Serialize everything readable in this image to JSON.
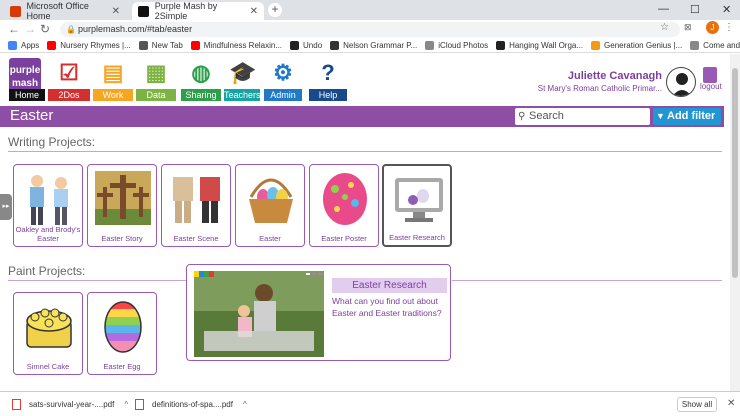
{
  "browser": {
    "tabs": [
      {
        "label": "Microsoft Office Home",
        "favicon_color": "#d83b01",
        "active": false
      },
      {
        "label": "Purple Mash by 2Simple",
        "favicon_color": "#111111",
        "active": true
      }
    ],
    "url": "purplemash.com/#tab/easter",
    "profile_initial": "J",
    "bookmarks": [
      {
        "label": "Apps",
        "icon_color": "#4285f4"
      },
      {
        "label": "Nursery Rhymes |...",
        "icon_color": "#ff0000"
      },
      {
        "label": "New Tab",
        "icon_color": "#555555"
      },
      {
        "label": "Mindfulness Relaxin...",
        "icon_color": "#ff0000"
      },
      {
        "label": "Undo",
        "icon_color": "#222222"
      },
      {
        "label": "Nelson Grammar P...",
        "icon_color": "#333333"
      },
      {
        "label": "iCloud Photos",
        "icon_color": "#888888"
      },
      {
        "label": "Hanging Wall Orga...",
        "icon_color": "#222222"
      },
      {
        "label": "Generation Genius |...",
        "icon_color": "#f39c12"
      },
      {
        "label": "Come and See",
        "icon_color": "#888888"
      }
    ]
  },
  "app": {
    "logo_top": "purple",
    "logo_bottom": "mash",
    "nav": [
      {
        "label": "Home",
        "color": "#111111"
      },
      {
        "label": "2Dos",
        "color": "#d32f2f"
      },
      {
        "label": "Work",
        "color": "#f5a623"
      },
      {
        "label": "Data",
        "color": "#7cb342"
      },
      {
        "label": "Sharing",
        "color": "#2e9e4a"
      },
      {
        "label": "Teachers",
        "color": "#16a3a3"
      },
      {
        "label": "Admin",
        "color": "#1f79c7"
      },
      {
        "label": "Help",
        "color": "#174a8b"
      }
    ],
    "user_name": "Juliette Cavanagh",
    "school": "St Mary's Roman Catholic Primar...",
    "logout_label": "logout"
  },
  "toolbar": {
    "title": "Easter",
    "search_placeholder": "Search",
    "filter_label": "Add filter"
  },
  "sections": [
    {
      "title": "Writing Projects:",
      "items": [
        "Oakley and Brody's Easter",
        "Easter Story",
        "Easter Scene",
        "Easter",
        "Easter Poster",
        "Easter Research"
      ]
    },
    {
      "title": "Paint Projects:",
      "items": [
        "Simnel Cake",
        "Easter Egg"
      ]
    }
  ],
  "popup": {
    "title": "Easter Research",
    "description": "What can you find out about Easter and Easter traditions?"
  },
  "downloads": {
    "items": [
      "sats-survival-year-....pdf",
      "definitions-of-spa....pdf"
    ],
    "show_all_label": "Show all"
  },
  "side_tab_label": "▸▸"
}
